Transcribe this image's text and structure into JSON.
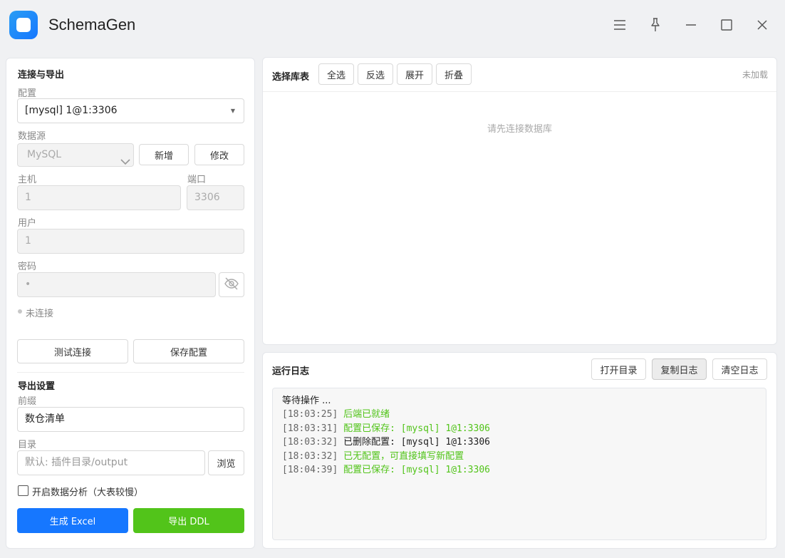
{
  "app": {
    "title": "SchemaGen"
  },
  "connect": {
    "section_title": "连接与导出",
    "config_label": "配置",
    "config_value": "[mysql] 1@1:3306",
    "datasource_label": "数据源",
    "datasource_value": "MySQL",
    "new_label": "新增",
    "edit_label": "修改",
    "host_label": "主机",
    "host_value": "1",
    "port_label": "端口",
    "port_value": "3306",
    "user_label": "用户",
    "user_value": "1",
    "password_label": "密码",
    "password_value": "•",
    "status_text": "未连接",
    "test_label": "测试连接",
    "save_label": "保存配置"
  },
  "export": {
    "section_title": "导出设置",
    "prefix_label": "前缀",
    "prefix_value": "数仓清单",
    "dir_label": "目录",
    "dir_placeholder": "默认: 插件目录/output",
    "browse_label": "浏览",
    "analysis_label": "开启数据分析（大表较慢）",
    "analysis_checked": false,
    "excel_label": "生成 Excel",
    "ddl_label": "导出 DDL"
  },
  "tables": {
    "title": "选择库表",
    "select_all": "全选",
    "invert": "反选",
    "expand": "展开",
    "collapse": "折叠",
    "status": "未加载",
    "empty_text": "请先连接数据库"
  },
  "log": {
    "title": "运行日志",
    "open_dir": "打开目录",
    "copy": "复制日志",
    "clear": "清空日志",
    "waiting": "等待操作 ...",
    "entries": [
      {
        "time": "[18:03:25]",
        "text": "后端已就绪",
        "level": "ok"
      },
      {
        "time": "[18:03:31]",
        "text": "配置已保存: [mysql] 1@1:3306",
        "level": "ok"
      },
      {
        "time": "[18:03:32]",
        "text": "已删除配置: [mysql] 1@1:3306",
        "level": "info"
      },
      {
        "time": "[18:03:32]",
        "text": "已无配置，可直接填写新配置",
        "level": "ok"
      },
      {
        "time": "[18:04:39]",
        "text": "配置已保存: [mysql] 1@1:3306",
        "level": "ok"
      }
    ]
  },
  "colors": {
    "primary": "#1677ff",
    "success": "#52c41a",
    "log_ok": "#52c41a"
  },
  "icons": {
    "titlebar": [
      "menu-icon",
      "pin-icon",
      "minimize-icon",
      "maximize-icon",
      "close-icon"
    ],
    "password": "eye-off-icon"
  }
}
